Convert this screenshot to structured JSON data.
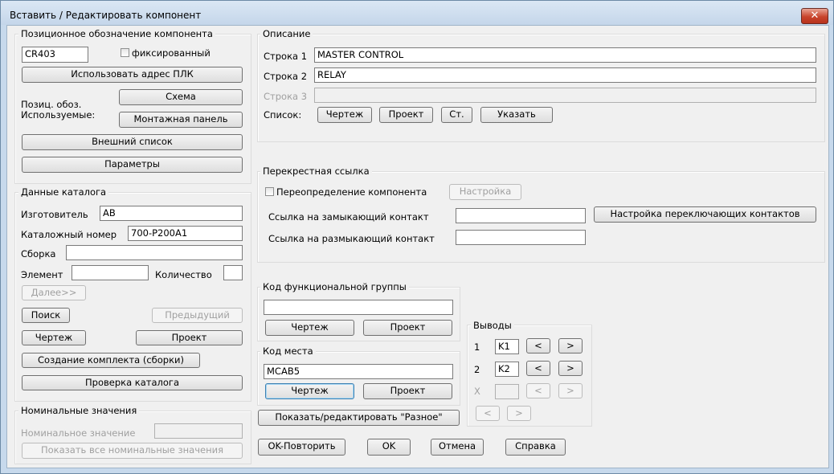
{
  "title": "Вставить / Редактировать компонент",
  "close_label": "✕",
  "designation": {
    "group": "Позиционное обозначение компонента",
    "tag_value": "CR403",
    "fixed_label": "фиксированный",
    "use_plc_address": "Использовать адрес ПЛК",
    "used_label_1": "Позиц. обоз.",
    "used_label_2": "Используемые:",
    "schematic_button": "Схема",
    "panel_button": "Монтажная панель",
    "external_list": "Внешний список",
    "options": "Параметры"
  },
  "catalog": {
    "group": "Данные каталога",
    "manufacturer_label": "Изготовитель",
    "manufacturer_value": "AB",
    "catalog_label": "Каталожный номер",
    "catalog_value": "700-P200A1",
    "assembly_label": "Сборка",
    "assembly_value": "",
    "item_label": "Элемент",
    "item_value": "",
    "count_label": "Количество",
    "count_value": "",
    "next_button": "Далее>>",
    "lookup_button": "Поиск",
    "previous_button": "Предыдущий",
    "drawing_button": "Чертеж",
    "project_button": "Проект",
    "multiple_catalog_button": "Создание комплекта (сборки)",
    "catalog_check_button": "Проверка каталога"
  },
  "ratings": {
    "group": "Номинальные значения",
    "rating_label": "Номинальное значение",
    "rating_value": "",
    "show_all_button": "Показать все номинальные значения"
  },
  "description": {
    "group": "Описание",
    "line1_label": "Строка 1",
    "line1_value": "MASTER CONTROL",
    "line2_label": "Строка 2",
    "line2_value": "RELAY",
    "line3_label": "Строка 3",
    "line3_value": "",
    "list_label": "Список:",
    "drawing_button": "Чертеж",
    "project_button": "Проект",
    "defaults_button": "Ст.",
    "pick_button": "Указать"
  },
  "crossref": {
    "group": "Перекрестная ссылка",
    "override_label": "Переопределение компонента",
    "setup_button": "Настройка",
    "no_label": "Ссылка на замыкающий контакт",
    "no_value": "",
    "nc_label": "Ссылка на размыкающий контакт",
    "nc_value": "",
    "switch_button": "Настройка переключающих контактов"
  },
  "installation": {
    "group": "Код функциональной группы",
    "value": "",
    "drawing_button": "Чертеж",
    "project_button": "Проект"
  },
  "location": {
    "group": "Код места",
    "value": "MCAB5",
    "drawing_button": "Чертеж",
    "project_button": "Проект"
  },
  "pins": {
    "group": "Выводы",
    "row1_label": "1",
    "row1_value": "K1",
    "row2_label": "2",
    "row2_value": "K2",
    "row3_label": "X",
    "row3_value": "",
    "prev_glyph": "<",
    "next_glyph": ">"
  },
  "misc_button": "Показать/редактировать \"Разное\"",
  "footer": {
    "ok_repeat": "OK-Повторить",
    "ok": "OK",
    "cancel": "Отмена",
    "help": "Справка"
  }
}
